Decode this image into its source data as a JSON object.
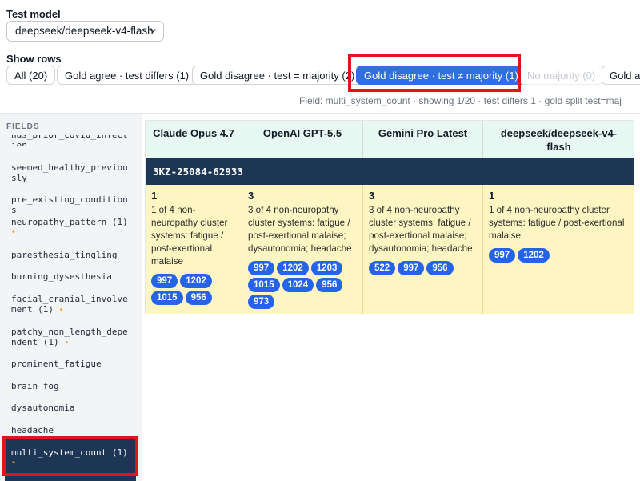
{
  "controls": {
    "test_model_label": "Test model",
    "model_select_value": "deepseek/deepseek-v4-flash",
    "show_rows_label": "Show rows",
    "filters": [
      {
        "label": "All (20)",
        "state": "normal"
      },
      {
        "label": "Gold agree · test differs (1)",
        "state": "normal"
      },
      {
        "label": "Gold disagree · test = majority (2)",
        "state": "normal"
      },
      {
        "label": "Gold disagree · test ≠ majority (1)",
        "state": "active"
      },
      {
        "label": "No majority (0)",
        "state": "disabled"
      },
      {
        "label": "Gold ag",
        "state": "normal"
      }
    ],
    "status": "Field: multi_system_count · showing 1/20 · test differs 1 · gold split test=maj"
  },
  "sidebar": {
    "heading": "FIELDS",
    "items": [
      {
        "label": "has_prior_covid_infection",
        "marked": false
      },
      {
        "label": "seemed_healthy_previously",
        "marked": false
      },
      {
        "label": "pre_existing_conditions",
        "marked": false
      },
      {
        "label": "neuropathy_pattern (1)",
        "marked": true
      },
      {
        "label": "paresthesia_tingling",
        "marked": false
      },
      {
        "label": "burning_dysesthesia",
        "marked": false
      },
      {
        "label": "facial_cranial_involvement (1)",
        "marked": true
      },
      {
        "label": "patchy_non_length_dependent (1)",
        "marked": true
      },
      {
        "label": "prominent_fatigue",
        "marked": false
      },
      {
        "label": "brain_fog",
        "marked": false
      },
      {
        "label": "dysautonomia",
        "marked": false
      },
      {
        "label": "headache",
        "marked": false
      },
      {
        "label": "multi_system_count (1)",
        "marked": true,
        "selected": true
      }
    ],
    "marker_glyph": "•"
  },
  "table": {
    "columns": [
      "Claude Opus 4.7",
      "OpenAI GPT-5.5",
      "Gemini Pro Latest",
      "deepseek/deepseek-v4-flash"
    ],
    "record_id": "3KZ-25084-62933",
    "cells": [
      {
        "count": "1",
        "reason": "1 of 4 non-neuropathy cluster systems: fatigue / post-exertional malaise",
        "refs": [
          "997",
          "1202",
          "1015",
          "956"
        ]
      },
      {
        "count": "3",
        "reason": "3 of 4 non-neuropathy cluster systems: fatigue / post-exertional malaise; dysautonomia; headache",
        "refs": [
          "997",
          "1202",
          "1203",
          "1015",
          "1024",
          "956",
          "973"
        ]
      },
      {
        "count": "3",
        "reason": "3 of 4 non-neuropathy cluster systems: fatigue / post-exertional malaise; dysautonomia; headache",
        "refs": [
          "522",
          "997",
          "956"
        ]
      },
      {
        "count": "1",
        "reason": "1 of 4 non-neuropathy cluster systems: fatigue / post-exertional malaise",
        "refs": [
          "997",
          "1202"
        ]
      }
    ]
  },
  "colors": {
    "accent_blue": "#2f6fe0",
    "navy": "#1e3656",
    "header_mint": "#e7f8f2",
    "cell_yellow": "#fdf6c3",
    "highlight_red": "#e3121b",
    "marker_orange": "#f59e0b"
  },
  "icons": {
    "select_caret": "chevron-down-icon"
  }
}
